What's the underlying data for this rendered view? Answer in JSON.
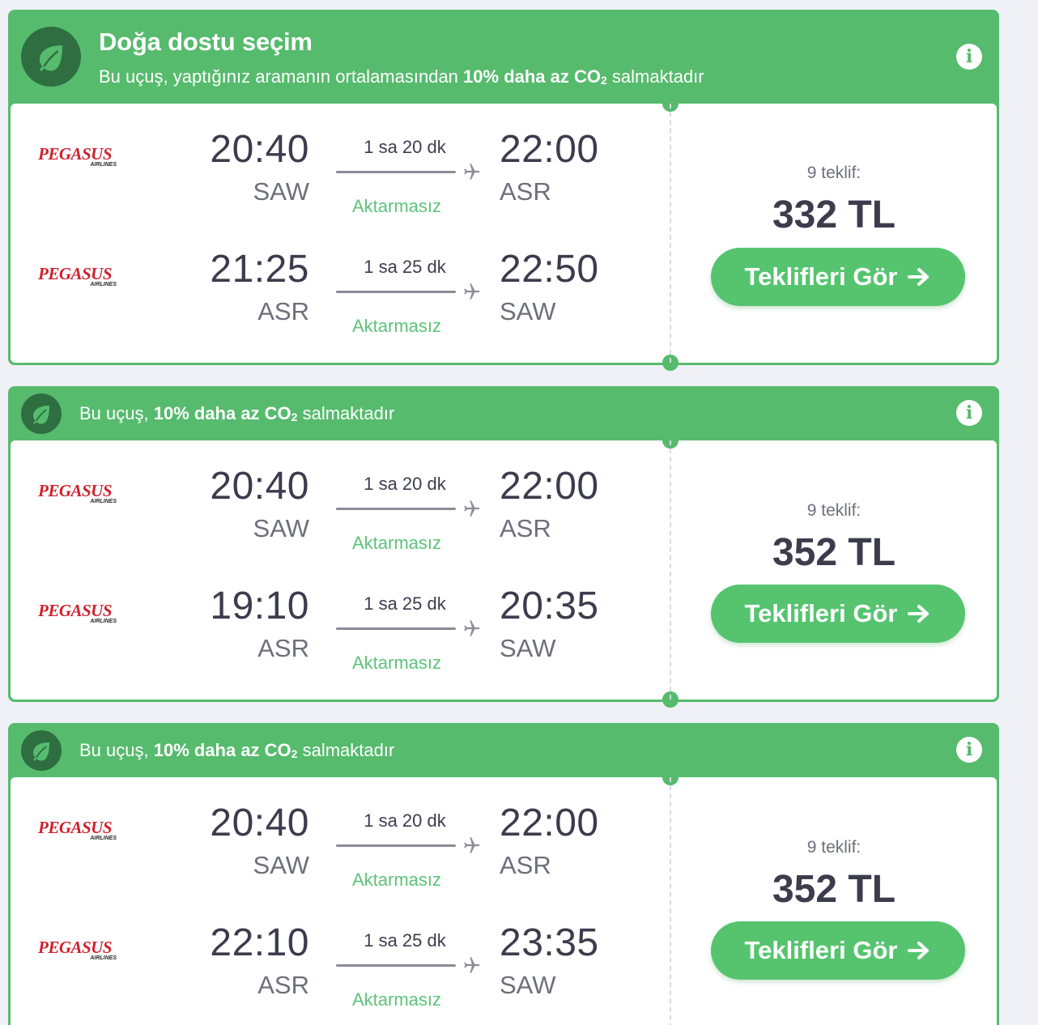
{
  "colors": {
    "eco_green": "#56bb6d",
    "button_green": "#56c46f",
    "stops_green": "#5dc47a",
    "airline_red": "#d0202d"
  },
  "icons": {
    "leaf": "leaf-icon",
    "info": "info-icon",
    "plane": "plane-icon",
    "arrow": "arrow-right-icon"
  },
  "cards": [
    {
      "eco_title": "Doğa dostu seçim",
      "eco_pre": "Bu uçuş, yaptığınız aramanın ortalamasından ",
      "eco_bold": "10% daha az CO",
      "eco_sub": "2",
      "eco_post": " salmaktadır",
      "legs": [
        {
          "airline": "PEGASUS",
          "airline_sub": "AIRLINES",
          "dep_time": "20:40",
          "dep_airport": "SAW",
          "duration": "1 sa 20 dk",
          "stops": "Aktarmasız",
          "arr_time": "22:00",
          "arr_airport": "ASR"
        },
        {
          "airline": "PEGASUS",
          "airline_sub": "AIRLINES",
          "dep_time": "21:25",
          "dep_airport": "ASR",
          "duration": "1 sa 25 dk",
          "stops": "Aktarmasız",
          "arr_time": "22:50",
          "arr_airport": "SAW"
        }
      ],
      "offers": "9 teklif:",
      "price": "332 TL",
      "button": "Teklifleri Gör"
    },
    {
      "eco_pre": "Bu uçuş, ",
      "eco_bold": "10% daha az CO",
      "eco_sub": "2",
      "eco_post": " salmaktadır",
      "legs": [
        {
          "airline": "PEGASUS",
          "airline_sub": "AIRLINES",
          "dep_time": "20:40",
          "dep_airport": "SAW",
          "duration": "1 sa 20 dk",
          "stops": "Aktarmasız",
          "arr_time": "22:00",
          "arr_airport": "ASR"
        },
        {
          "airline": "PEGASUS",
          "airline_sub": "AIRLINES",
          "dep_time": "19:10",
          "dep_airport": "ASR",
          "duration": "1 sa 25 dk",
          "stops": "Aktarmasız",
          "arr_time": "20:35",
          "arr_airport": "SAW"
        }
      ],
      "offers": "9 teklif:",
      "price": "352 TL",
      "button": "Teklifleri Gör"
    },
    {
      "eco_pre": "Bu uçuş, ",
      "eco_bold": "10% daha az CO",
      "eco_sub": "2",
      "eco_post": " salmaktadır",
      "legs": [
        {
          "airline": "PEGASUS",
          "airline_sub": "AIRLINES",
          "dep_time": "20:40",
          "dep_airport": "SAW",
          "duration": "1 sa 20 dk",
          "stops": "Aktarmasız",
          "arr_time": "22:00",
          "arr_airport": "ASR"
        },
        {
          "airline": "PEGASUS",
          "airline_sub": "AIRLINES",
          "dep_time": "22:10",
          "dep_airport": "ASR",
          "duration": "1 sa 25 dk",
          "stops": "Aktarmasız",
          "arr_time": "23:35",
          "arr_airport": "SAW"
        }
      ],
      "offers": "9 teklif:",
      "price": "352 TL",
      "button": "Teklifleri Gör"
    }
  ]
}
